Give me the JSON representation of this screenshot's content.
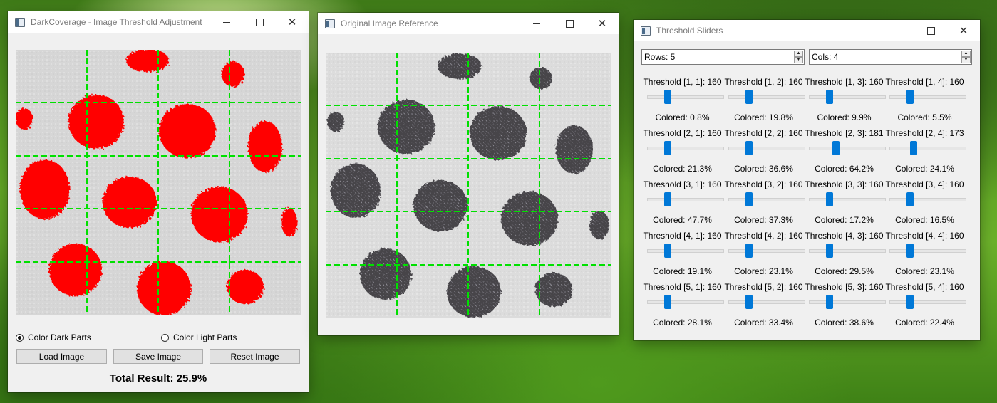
{
  "main_window": {
    "title": "DarkCoverage - Image Threshold Adjustment",
    "radio_dark": "Color Dark Parts",
    "radio_light": "Color Light Parts",
    "selected_radio": "dark",
    "load_button": "Load Image",
    "save_button": "Save Image",
    "reset_button": "Reset Image",
    "total_result": "Total Result: 25.9%",
    "overlay_color": "#ff0000",
    "grid_color": "#00e000"
  },
  "reference_window": {
    "title": "Original Image Reference",
    "spot_color": "#4a484c"
  },
  "threshold_window": {
    "title": "Threshold Sliders",
    "rows_label": "Rows: 5",
    "cols_label": "Cols: 4",
    "slider_min": 0,
    "slider_max": 255,
    "accent_color": "#0078d7",
    "cells": [
      [
        {
          "label": "Threshold [1, 1]: 160",
          "value": 160,
          "colored": "Colored: 0.8%"
        },
        {
          "label": "Threshold [1, 2]: 160",
          "value": 160,
          "colored": "Colored: 19.8%"
        },
        {
          "label": "Threshold [1, 3]: 160",
          "value": 160,
          "colored": "Colored: 9.9%"
        },
        {
          "label": "Threshold [1, 4]: 160",
          "value": 160,
          "colored": "Colored: 5.5%"
        }
      ],
      [
        {
          "label": "Threshold [2, 1]: 160",
          "value": 160,
          "colored": "Colored: 21.3%"
        },
        {
          "label": "Threshold [2, 2]: 160",
          "value": 160,
          "colored": "Colored: 36.6%"
        },
        {
          "label": "Threshold [2, 3]: 181",
          "value": 181,
          "colored": "Colored: 64.2%"
        },
        {
          "label": "Threshold [2, 4]: 173",
          "value": 173,
          "colored": "Colored: 24.1%"
        }
      ],
      [
        {
          "label": "Threshold [3, 1]: 160",
          "value": 160,
          "colored": "Colored: 47.7%"
        },
        {
          "label": "Threshold [3, 2]: 160",
          "value": 160,
          "colored": "Colored: 37.3%"
        },
        {
          "label": "Threshold [3, 3]: 160",
          "value": 160,
          "colored": "Colored: 17.2%"
        },
        {
          "label": "Threshold [3, 4]: 160",
          "value": 160,
          "colored": "Colored: 16.5%"
        }
      ],
      [
        {
          "label": "Threshold [4, 1]: 160",
          "value": 160,
          "colored": "Colored: 19.1%"
        },
        {
          "label": "Threshold [4, 2]: 160",
          "value": 160,
          "colored": "Colored: 23.1%"
        },
        {
          "label": "Threshold [4, 3]: 160",
          "value": 160,
          "colored": "Colored: 29.5%"
        },
        {
          "label": "Threshold [4, 4]: 160",
          "value": 160,
          "colored": "Colored: 23.1%"
        }
      ],
      [
        {
          "label": "Threshold [5, 1]: 160",
          "value": 160,
          "colored": "Colored: 28.1%"
        },
        {
          "label": "Threshold [5, 2]: 160",
          "value": 160,
          "colored": "Colored: 33.4%"
        },
        {
          "label": "Threshold [5, 3]: 160",
          "value": 160,
          "colored": "Colored: 38.6%"
        },
        {
          "label": "Threshold [5, 4]: 160",
          "value": 160,
          "colored": "Colored: 22.4%"
        }
      ]
    ]
  }
}
